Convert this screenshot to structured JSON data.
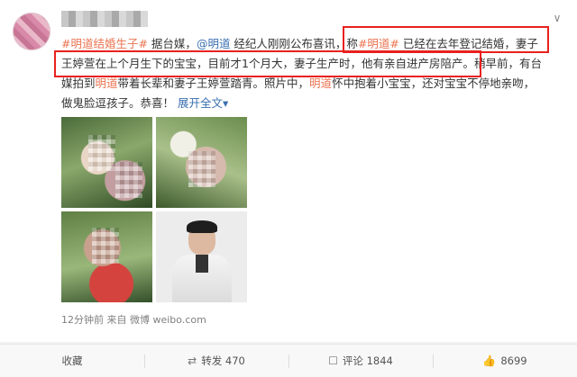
{
  "post": {
    "line1": {
      "tag1": "#明道结婚生子#",
      "t1": " 据台媒，",
      "mention": "@明道",
      "t2": " 经纪人刚刚公布喜讯，称",
      "tag2": "#明道#",
      "t3": " 已经在去年登记结婚，妻子"
    },
    "line2": {
      "t1": "王婷萱在上个月生下的宝宝，目前才1个月大，妻子生产时，他有亲自进产房陪产。",
      "t2": "稍早前，有台"
    },
    "line3": {
      "t1": "媒拍到",
      "name": "明道",
      "t2": "带着长辈和妻子王婷萱踏青。照片中，",
      "name2": "明道",
      "t3": "怀中抱着小宝宝，还对宝宝不停地亲吻，"
    },
    "line4": {
      "t1": "做鬼脸逗孩子。恭喜！ ",
      "expand": "展开全文",
      "expand_icon": "▾"
    },
    "meta": "12分钟前 来自 微博 weibo.com",
    "more_icon": "∨"
  },
  "actions": {
    "collect": "收藏",
    "repost_icon": "⇄",
    "repost": "转发 470",
    "comment_icon": "☐",
    "comment": "评论 1844",
    "like_icon": "👍",
    "like": "8699"
  },
  "colors": {
    "link": "#eb7350",
    "mention": "#3a6fb0",
    "highlight_box": "#e8211f"
  }
}
